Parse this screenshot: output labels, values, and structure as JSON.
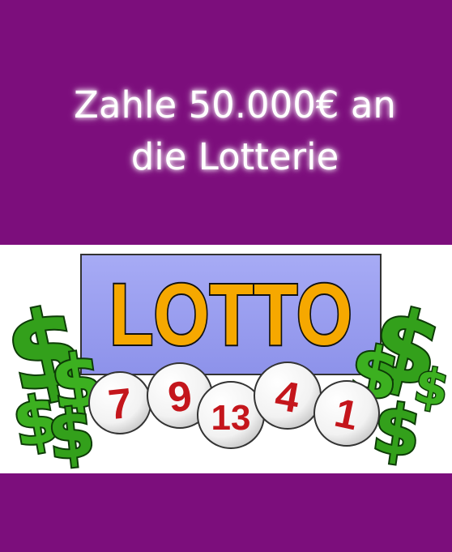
{
  "headline": {
    "line1": "Zahle 50.000€ an",
    "line2": "die Lotterie"
  },
  "illustration": {
    "logo_word": "LOTTO",
    "balls": [
      "7",
      "9",
      "13",
      "4",
      "1"
    ],
    "dollar_glyph": "$"
  },
  "colors": {
    "band": "#7c0e7c",
    "panel": "#9b9ff0",
    "logo_fill": "#f6a800",
    "ball_number": "#c4161c",
    "dollar_green": "#33a01b"
  }
}
